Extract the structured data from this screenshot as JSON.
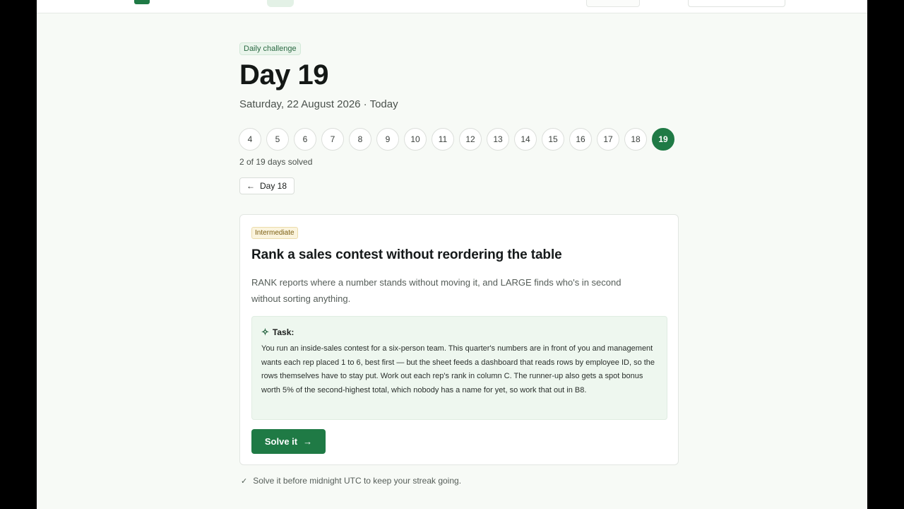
{
  "challenge": {
    "badge": "Daily challenge",
    "title": "Day 19",
    "date_line": "Saturday, 22 August 2026 · Today"
  },
  "day_strip": {
    "days": [
      "4",
      "5",
      "6",
      "7",
      "8",
      "9",
      "10",
      "11",
      "12",
      "13",
      "14",
      "15",
      "16",
      "17",
      "18",
      "19"
    ],
    "active": "19"
  },
  "progress": {
    "solved_text": "2 of 19 days solved"
  },
  "nav": {
    "prev_icon": "arrow-left-icon",
    "prev_label": "Day 18"
  },
  "card": {
    "level": "Intermediate",
    "title": "Rank a sales contest without reordering the table",
    "description": "RANK reports where a number stands without moving it, and LARGE finds who's in second without sorting anything.",
    "task_icon": "sparkle-icon",
    "task_label": "Task:",
    "task_text": "You run an inside-sales contest for a six-person team. This quarter's numbers are in front of you and management wants each rep placed 1 to 6, best first — but the sheet feeds a dashboard that reads rows by employee ID, so the rows themselves have to stay put. Work out each rep's rank in column C. The runner-up also gets a spot bonus worth 5% of the second-highest total, which nobody has a name for yet, so work that out in B8.",
    "solve_label": "Solve it",
    "solve_icon": "arrow-right-icon"
  },
  "footnote": {
    "icon": "check-icon",
    "text": "Solve it before midnight UTC to keep your streak going."
  },
  "colors": {
    "accent": "#1f7a45",
    "task_bg": "#eef7ef",
    "level_bg": "#fbf4de"
  }
}
